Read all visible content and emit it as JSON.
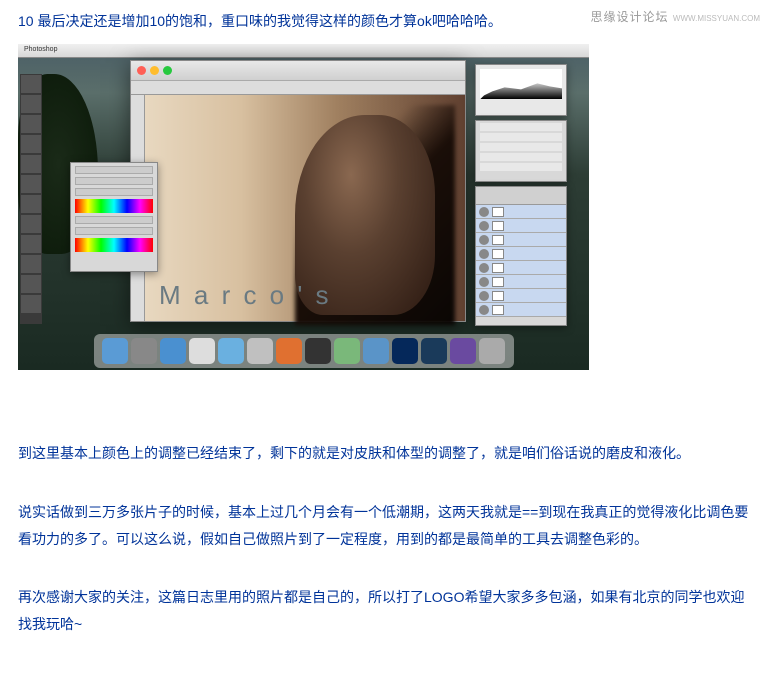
{
  "watermark": {
    "main": "思缘设计论坛",
    "sub": "WWW.MISSYUAN.COM"
  },
  "heading": "10 最后决定还是增加10的饱和，重口味的我觉得这样的颜色才算ok吧哈哈哈。",
  "screenshot": {
    "app_label": "Photoshop",
    "image_watermark": "M a r c o ' s"
  },
  "paragraphs": {
    "p1": "到这里基本上颜色上的调整已经结束了，剩下的就是对皮肤和体型的调整了，就是咱们俗话说的磨皮和液化。",
    "p2": "说实话做到三万多张片子的时候，基本上过几个月会有一个低潮期，这两天我就是==到现在我真正的觉得液化比调色要看功力的多了。可以这么说，假如自己做照片到了一定程度，用到的都是最简单的工具去调整色彩的。",
    "p3": "再次感谢大家的关注，这篇日志里用的照片都是自己的，所以打了LOGO希望大家多多包涵，如果有北京的同学也欢迎找我玩哈~"
  }
}
